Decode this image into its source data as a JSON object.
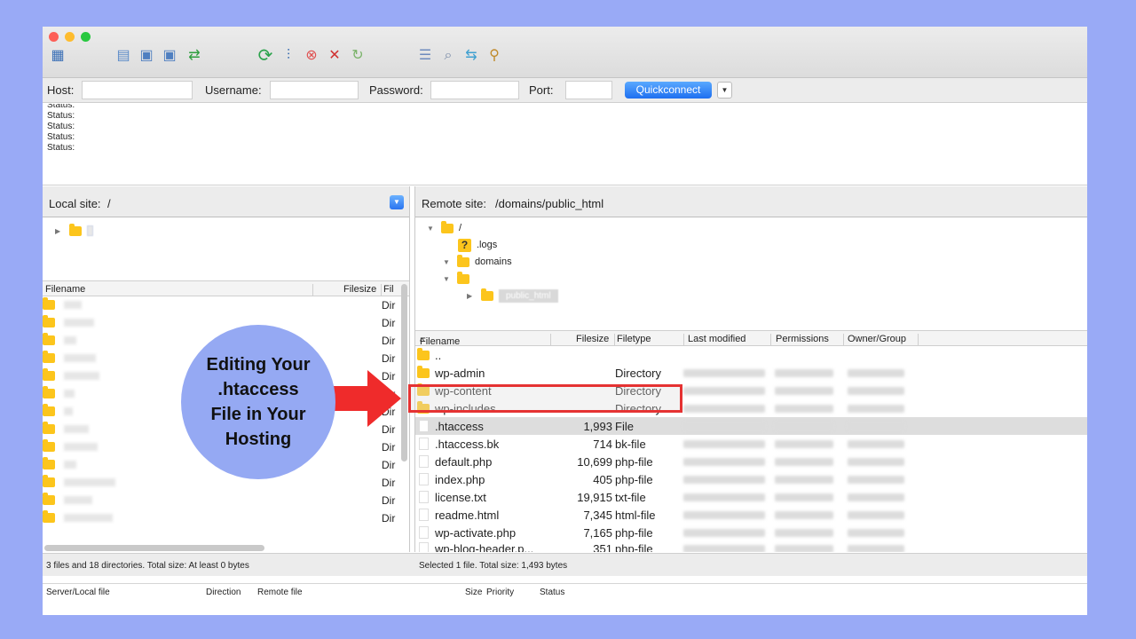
{
  "colors": {
    "background": "#99aaf6",
    "accent_blue": "#1e6ff0",
    "highlight_red": "#e53232",
    "folder_yellow": "#fcc51c",
    "callout_circle": "#95a9f3"
  },
  "toolbar_icons": [
    "site-manager-icon",
    "toggle-log-icon",
    "toggle-tree-icon",
    "toggle-remote-tree-icon",
    "transfer-queue-icon",
    "refresh-icon",
    "filter-icon",
    "cancel-icon",
    "disconnect-icon",
    "reconnect-icon",
    "compare-icon",
    "search-icon",
    "sync-browse-icon",
    "find-files-icon"
  ],
  "quickconnect": {
    "host_label": "Host:",
    "username_label": "Username:",
    "password_label": "Password:",
    "port_label": "Port:",
    "button_label": "Quickconnect",
    "host_value": "",
    "username_value": "",
    "password_value": "",
    "port_value": ""
  },
  "log": {
    "lines": [
      "Status:",
      "Status:",
      "Status:",
      "Status:",
      "Status:"
    ]
  },
  "local": {
    "site_label": "Local site:",
    "path": "/",
    "col_filename": "Filename",
    "col_filesize": "Filesize",
    "col_filetype": "Fil",
    "rows": [
      "Dir",
      "Dir",
      "Dir",
      "Dir",
      "Dir",
      "Dir",
      "Dir",
      "Dir",
      "Dir",
      "Dir",
      "Dir",
      "Dir",
      "Dir"
    ],
    "status": "3 files and 18 directories. Total size: At least 0 bytes"
  },
  "remote": {
    "site_label": "Remote site:",
    "path": "/domains/public_html",
    "tree": {
      "root": "/",
      "logs": ".logs",
      "domains": "domains",
      "public_html": "public_html"
    },
    "col_filename": "Filename",
    "col_filesize": "Filesize",
    "col_filetype": "Filetype",
    "col_modified": "Last modified",
    "col_permissions": "Permissions",
    "col_owner": "Owner/Group",
    "rows": [
      {
        "name": "..",
        "size": "",
        "type": ""
      },
      {
        "name": "wp-admin",
        "size": "",
        "type": "Directory"
      },
      {
        "name": "wp-content",
        "size": "",
        "type": "Directory"
      },
      {
        "name": "wp-includes",
        "size": "",
        "type": "Directory"
      },
      {
        "name": ".htaccess",
        "size": "1,993",
        "type": "File"
      },
      {
        "name": ".htaccess.bk",
        "size": "714",
        "type": "bk-file"
      },
      {
        "name": "default.php",
        "size": "10,699",
        "type": "php-file"
      },
      {
        "name": "index.php",
        "size": "405",
        "type": "php-file"
      },
      {
        "name": "license.txt",
        "size": "19,915",
        "type": "txt-file"
      },
      {
        "name": "readme.html",
        "size": "7,345",
        "type": "html-file"
      },
      {
        "name": "wp-activate.php",
        "size": "7,165",
        "type": "php-file"
      },
      {
        "name": "wp-blog-header.p...",
        "size": "351",
        "type": "php-file"
      }
    ],
    "status": "Selected 1 file. Total size: 1,493 bytes"
  },
  "queue": {
    "col_server": "Server/Local file",
    "col_direction": "Direction",
    "col_remote": "Remote file",
    "col_size": "Size",
    "col_priority": "Priority",
    "col_status": "Status"
  },
  "callout": {
    "text": "Editing Your\n.htaccess\nFile in Your\nHosting"
  }
}
